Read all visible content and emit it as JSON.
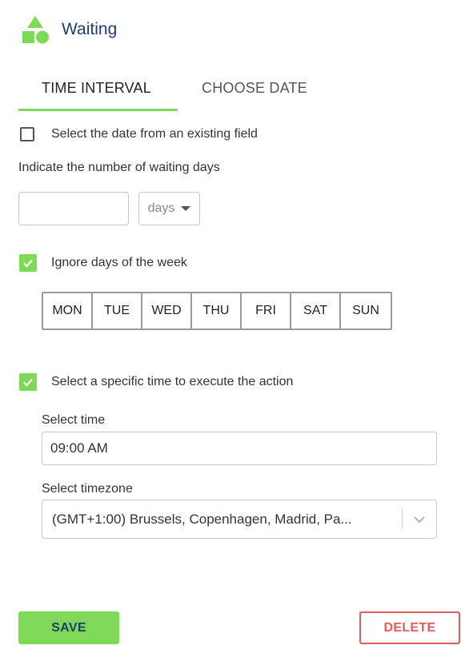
{
  "header": {
    "title": "Waiting",
    "icon": "shapes-icon",
    "accent_color": "#7ed957",
    "title_color": "#1d3f6e"
  },
  "tabs": [
    {
      "label": "TIME INTERVAL",
      "active": true
    },
    {
      "label": "CHOOSE DATE",
      "active": false
    }
  ],
  "existing_field": {
    "label": "Select the date from an existing field",
    "checked": false
  },
  "waiting_days": {
    "label": "Indicate the number of waiting days",
    "value": "",
    "unit_selected": "days"
  },
  "ignore_days": {
    "label": "Ignore days of the week",
    "checked": true,
    "days": [
      "MON",
      "TUE",
      "WED",
      "THU",
      "FRI",
      "SAT",
      "SUN"
    ]
  },
  "specific_time": {
    "label": "Select a specific time to execute the action",
    "checked": true,
    "time_label": "Select time",
    "time_value": "09:00 AM",
    "timezone_label": "Select timezone",
    "timezone_value": "(GMT+1:00) Brussels, Copenhagen, Madrid, Pa..."
  },
  "actions": {
    "save_label": "SAVE",
    "delete_label": "DELETE",
    "delete_color": "#e35b5b"
  }
}
